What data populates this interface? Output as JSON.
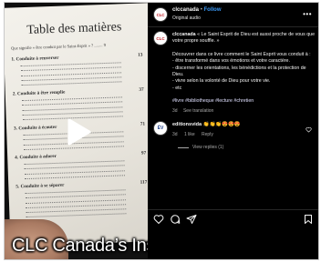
{
  "media": {
    "book": {
      "title": "Table des matières",
      "intro": "Que signifie « être conduit par le Saint-Esprit » ? ........ 9",
      "chapters": [
        {
          "title": "1. Conduite à renverser",
          "page": "13"
        },
        {
          "title": "2. Conduite à être remplie",
          "page": "37"
        },
        {
          "title": "3. Conduite à écouter",
          "page": "71"
        },
        {
          "title": "4. Conduite à adorer",
          "page": "97"
        },
        {
          "title": "5. Conduite à se séparer",
          "page": "117"
        }
      ]
    },
    "caption": "CLC Canada’s Instagram"
  },
  "post": {
    "username": "clccanada",
    "separator": "•",
    "follow_label": "Follow",
    "audio_label": "Original audio",
    "avatar_text": "CLC",
    "caption": {
      "username": "clccanada",
      "paragraph1": "« Le Saint Esprit de Dieu est aussi proche de vous que votre propre souffle. »",
      "paragraph2_intro": "Découvrer dans ce livre comment le Saint Esprit vous conduit à :",
      "bullets": [
        "- être transformé dans vos émotions et votre caractère.",
        "- discerner les orientations, les bénédictions et la protection de Dieu.",
        "- vivre selon la volonté de Dieu pour votre vie.",
        "- etc"
      ],
      "hashtags": "#livre #bibliotheque #lecture #chretien",
      "time": "3d",
      "translation_label": "See translation"
    },
    "comment": {
      "avatar_text": "ÉV",
      "username": "editionsvida",
      "text": "👏👏👏😍😍😍",
      "time": "3d",
      "likes": "1 like",
      "reply_label": "Reply",
      "view_replies": "View replies (1)"
    }
  },
  "colors": {
    "background": "#000000",
    "link": "#3b9af8",
    "muted": "#a8a8a8",
    "text": "#f5f5f5"
  },
  "icons": [
    "play-icon",
    "more-options-icon",
    "heart-icon",
    "comment-icon",
    "share-icon",
    "save-icon"
  ]
}
